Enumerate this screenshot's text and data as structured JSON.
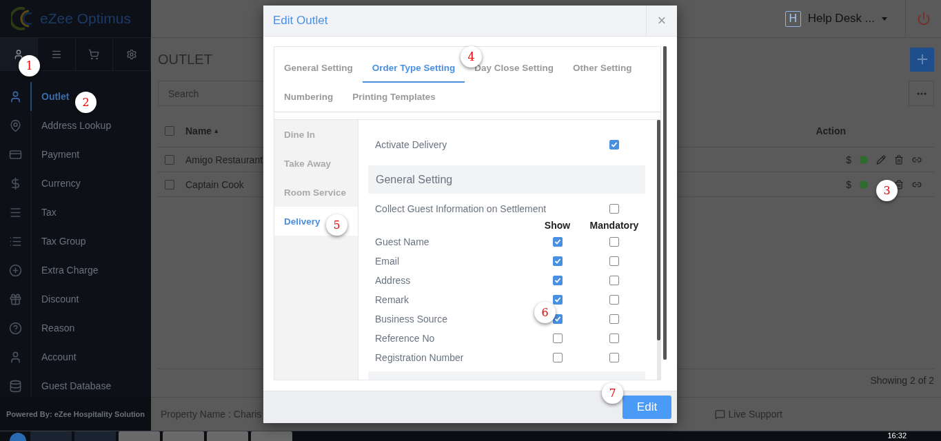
{
  "brand": {
    "name": "eZee Optimus"
  },
  "sidebar": {
    "tabs": [
      {
        "selected": true
      },
      {
        "selected": false
      },
      {
        "selected": false
      },
      {
        "selected": false
      }
    ],
    "items": [
      {
        "label": "Outlet",
        "selected": true
      },
      {
        "label": "Address Lookup",
        "selected": false
      },
      {
        "label": "Payment",
        "selected": false
      },
      {
        "label": "Currency",
        "selected": false
      },
      {
        "label": "Tax",
        "selected": false
      },
      {
        "label": "Tax Group",
        "selected": false
      },
      {
        "label": "Extra Charge",
        "selected": false
      },
      {
        "label": "Discount",
        "selected": false
      },
      {
        "label": "Reason",
        "selected": false
      },
      {
        "label": "Account",
        "selected": false
      },
      {
        "label": "Guest Database",
        "selected": false
      }
    ],
    "footer": "Powered By: eZee Hospitality Solution"
  },
  "header": {
    "badge": "H",
    "user": "Help Desk ..."
  },
  "page": {
    "title": "OUTLET",
    "search": {
      "placeholder": "Search"
    },
    "table": {
      "columns": [
        "Name",
        "Action"
      ],
      "sort_indicator": "▴",
      "all_checked": false,
      "rows": [
        {
          "name": "Amigo Restaurant",
          "currency": "$",
          "color": "#2e6b2e",
          "checked": false
        },
        {
          "name": "Captain Cook",
          "currency": "$",
          "color": "#2e6b2e",
          "checked": false
        }
      ]
    },
    "showing": "Showing 2 of 2"
  },
  "footer": {
    "property": "Property Name : Charis",
    "support": "Live Support"
  },
  "modal": {
    "title": "Edit Outlet",
    "close": "×",
    "tab_rows": [
      [
        {
          "label": "General Setting",
          "selected": false
        },
        {
          "label": "Order Type Setting",
          "selected": true
        },
        {
          "label": "Day Close Setting",
          "selected": false
        },
        {
          "label": "Other Setting",
          "selected": false
        }
      ],
      [
        {
          "label": "Numbering",
          "selected": false
        },
        {
          "label": "Printing Templates",
          "selected": false
        }
      ]
    ],
    "order_types": [
      {
        "label": "Dine In",
        "selected": false
      },
      {
        "label": "Take Away",
        "selected": false
      },
      {
        "label": "Room Service",
        "selected": false
      },
      {
        "label": "Delivery",
        "selected": true
      }
    ],
    "activate": {
      "label": "Activate Delivery",
      "checked": true
    },
    "section": "General Setting",
    "collect": {
      "label": "Collect Guest Information on Settlement",
      "checked": false
    },
    "columns": [
      "Show",
      "Mandatory"
    ],
    "fields": [
      {
        "label": "Guest Name",
        "show": true,
        "mandatory": false
      },
      {
        "label": "Email",
        "show": true,
        "mandatory": false
      },
      {
        "label": "Address",
        "show": true,
        "mandatory": false
      },
      {
        "label": "Remark",
        "show": true,
        "mandatory": false
      },
      {
        "label": "Business Source",
        "show": true,
        "mandatory": false
      },
      {
        "label": "Reference No",
        "show": false,
        "mandatory": false
      },
      {
        "label": "Registration Number",
        "show": false,
        "mandatory": false
      }
    ],
    "button": "Edit"
  },
  "callouts": [
    "1",
    "2",
    "3",
    "4",
    "5",
    "6",
    "7"
  ],
  "taskbar": {
    "time": "16:32"
  }
}
